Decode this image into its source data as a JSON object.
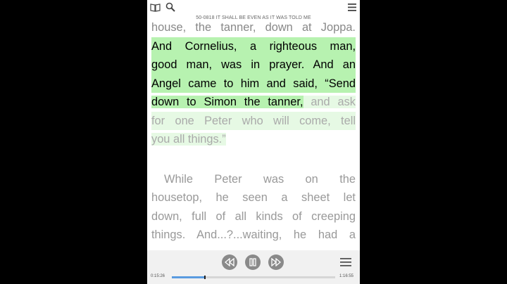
{
  "header": {
    "book_icon": "book-icon",
    "search_icon": "search-icon",
    "menu_icon": "menu-icon",
    "subtitle": "50-0818 IT SHALL BE EVEN AS IT WAS TOLD ME"
  },
  "reader": {
    "para1": {
      "line0": "house, the tanner, down at Joppa.",
      "line1": "And Cornelius, a righteous man,",
      "line2": "good man, was in prayer. And an",
      "line3": "Angel came to him and said, “Send",
      "line4_hl": "down to Simon the tanner,",
      "line4_rest": " and ask",
      "line5": "for one Peter who will come, tell",
      "line6": "you all things.”"
    },
    "para2": {
      "line1": "While Peter was on the",
      "line2": "housetop, he seen a sheet let",
      "line3": "down, full of all kinds of creeping",
      "line4": "things. And...?...waiting, he had a"
    }
  },
  "player": {
    "rewind_icon": "rewind-10-icon",
    "pause_icon": "pause-icon",
    "forward_icon": "forward-10-icon",
    "list_icon": "list-icon",
    "elapsed": "0:15:26",
    "total": "1:16:55",
    "progress": 0.2
  },
  "colors": {
    "highlight_read": "#b7f2b0",
    "highlight_upcoming": "#e6f9e4",
    "progress": "#5a9be0"
  }
}
